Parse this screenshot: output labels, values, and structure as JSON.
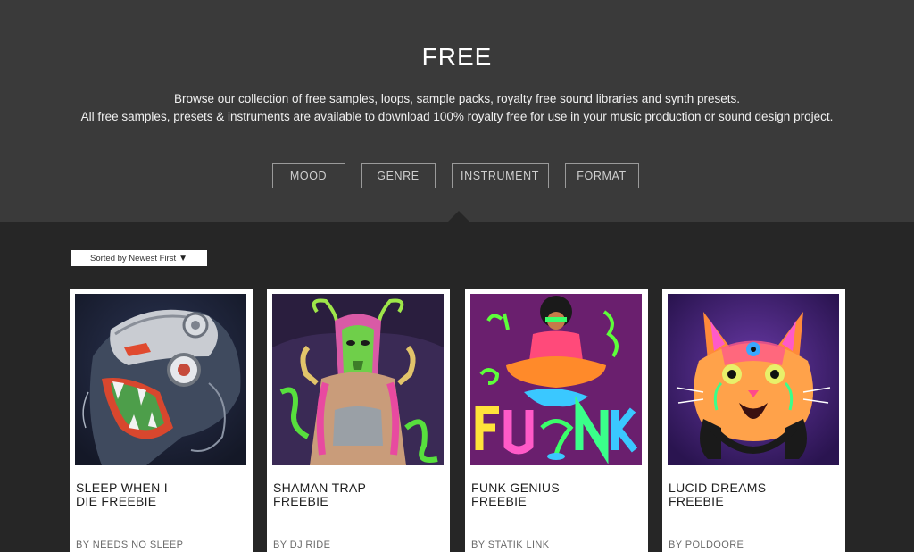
{
  "hero": {
    "title": "FREE",
    "description_line1": "Browse our collection of free samples, loops, sample packs, royalty free sound libraries and synth presets.",
    "description_line2": "All free samples, presets & instruments are available to download 100% royalty free for use in your music production or sound design project."
  },
  "filters": [
    {
      "label": "MOOD"
    },
    {
      "label": "GENRE"
    },
    {
      "label": "INSTRUMENT"
    },
    {
      "label": "FORMAT"
    }
  ],
  "sort": {
    "label": "Sorted by Newest First",
    "arrow": "▼"
  },
  "products": [
    {
      "title": "SLEEP WHEN I\nDIE FREEBIE",
      "artist": "BY NEEDS NO SLEEP",
      "art": "cyborg-tiger-artwork"
    },
    {
      "title": "SHAMAN TRAP\nFREEBIE",
      "artist": "BY DJ RIDE",
      "art": "shaman-mask-artwork"
    },
    {
      "title": "FUNK GENIUS\nFREEBIE",
      "artist": "BY STATIK LINK",
      "art": "funk-lettering-artwork"
    },
    {
      "title": "LUCID DREAMS\nFREEBIE",
      "artist": "BY POLDOORE",
      "art": "psychedelic-cat-artwork"
    }
  ],
  "colors": {
    "hero_bg": "#3a3a3a",
    "page_bg": "#262626",
    "card_bg": "#ffffff"
  }
}
